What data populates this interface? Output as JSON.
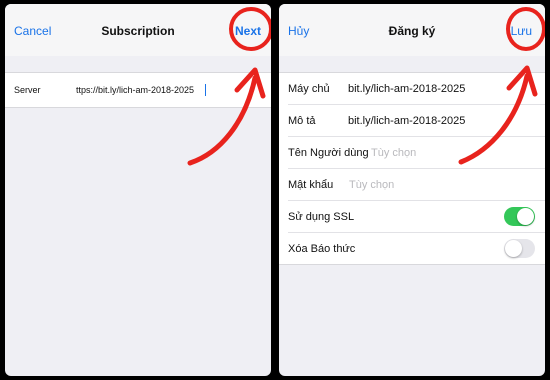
{
  "left_panel": {
    "nav": {
      "cancel_label": "Cancel",
      "title": "Subscription",
      "next_label": "Next"
    },
    "fields": [
      {
        "label": "Server",
        "value": "ttps://bit.ly/lich-am-2018-2025"
      }
    ]
  },
  "right_panel": {
    "nav": {
      "cancel_label": "Hủy",
      "title": "Đăng ký",
      "save_label": "Lưu"
    },
    "fields": [
      {
        "label": "Máy chủ",
        "value": "bit.ly/lich-am-2018-2025"
      },
      {
        "label": "Mô tả",
        "value": "bit.ly/lich-am-2018-2025"
      },
      {
        "label": "Tên Người dùng",
        "placeholder": "Tùy chọn"
      },
      {
        "label": "Mật khẩu",
        "placeholder": "Tùy chọn"
      }
    ],
    "toggles": [
      {
        "label": "Sử dụng SSL",
        "on": true
      },
      {
        "label": "Xóa Báo thức",
        "on": false
      }
    ]
  },
  "colors": {
    "accent": "#1a73e8",
    "toggle_on": "#34c759",
    "annotation": "#e8231d"
  }
}
